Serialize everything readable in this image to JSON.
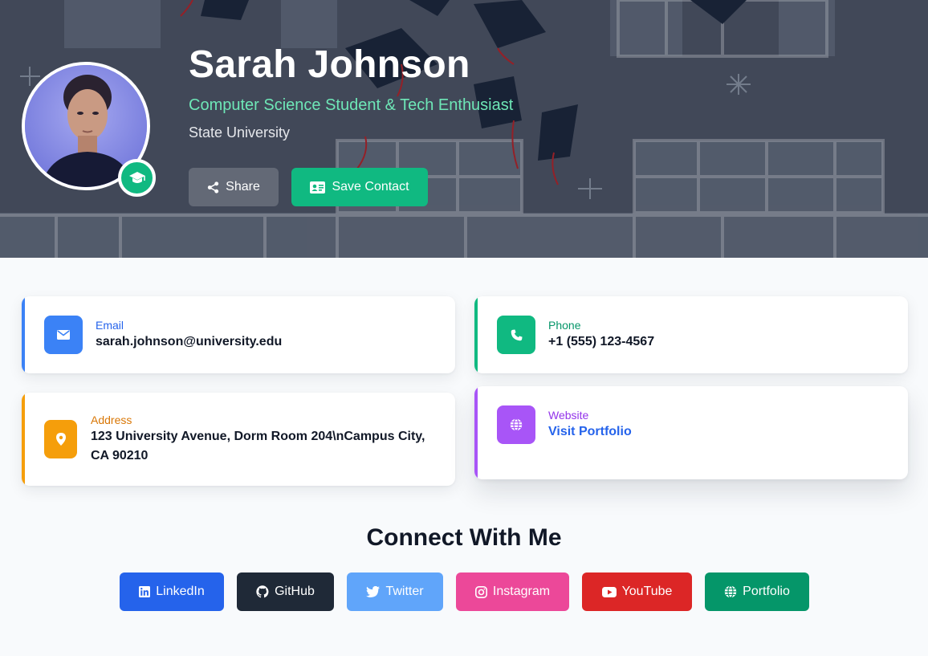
{
  "profile": {
    "name": "Sarah Johnson",
    "tagline": "Computer Science Student & Tech Enthusiast",
    "school": "State University",
    "badge_icon": "graduation-cap-icon"
  },
  "actions": {
    "share_label": "Share",
    "save_label": "Save Contact"
  },
  "contact": {
    "email": {
      "label": "Email",
      "value": "sarah.johnson@university.edu",
      "icon": "envelope-icon",
      "color": "#3b82f6"
    },
    "phone": {
      "label": "Phone",
      "value": "+1 (555) 123-4567",
      "icon": "phone-icon",
      "color": "#10b981"
    },
    "address": {
      "label": "Address",
      "value": "123 University Avenue, Dorm Room 204\\nCampus City, CA 90210",
      "icon": "map-pin-icon",
      "color": "#f59e0b"
    },
    "website": {
      "label": "Website",
      "value": "Visit Portfolio",
      "icon": "globe-icon",
      "color": "#a855f7"
    }
  },
  "connect": {
    "title": "Connect With Me",
    "links": [
      {
        "label": "LinkedIn",
        "icon": "linkedin-icon",
        "color": "#2563eb"
      },
      {
        "label": "GitHub",
        "icon": "github-icon",
        "color": "#1f2937"
      },
      {
        "label": "Twitter",
        "icon": "twitter-icon",
        "color": "#60a5fa"
      },
      {
        "label": "Instagram",
        "icon": "instagram-icon",
        "color": "#ec4899"
      },
      {
        "label": "YouTube",
        "icon": "youtube-icon",
        "color": "#dc2626"
      },
      {
        "label": "Portfolio",
        "icon": "globe-icon",
        "color": "#059669"
      }
    ]
  }
}
